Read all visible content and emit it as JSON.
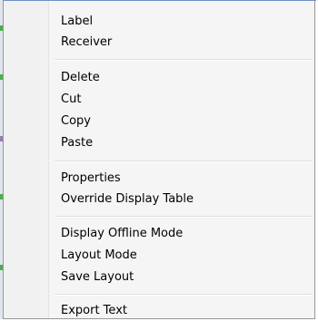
{
  "context_menu": {
    "items": [
      {
        "label": "Label"
      },
      {
        "label": "Receiver"
      },
      {
        "label": "Delete"
      },
      {
        "label": "Cut"
      },
      {
        "label": "Copy"
      },
      {
        "label": "Paste"
      },
      {
        "label": "Properties"
      },
      {
        "label": "Override Display Table"
      },
      {
        "label": "Display Offline Mode"
      },
      {
        "label": "Layout Mode"
      },
      {
        "label": "Save Layout"
      },
      {
        "label": "Export Text"
      }
    ]
  },
  "colors": {
    "menu_background": "#f5f5f5",
    "menu_border": "#979797",
    "gutter": "#f1f1f1",
    "separator": "#e0e0e0",
    "text": "#000000",
    "underlying_edge_blue": "#6f8fc4",
    "underlying_edge_green": "#4cae4c"
  }
}
